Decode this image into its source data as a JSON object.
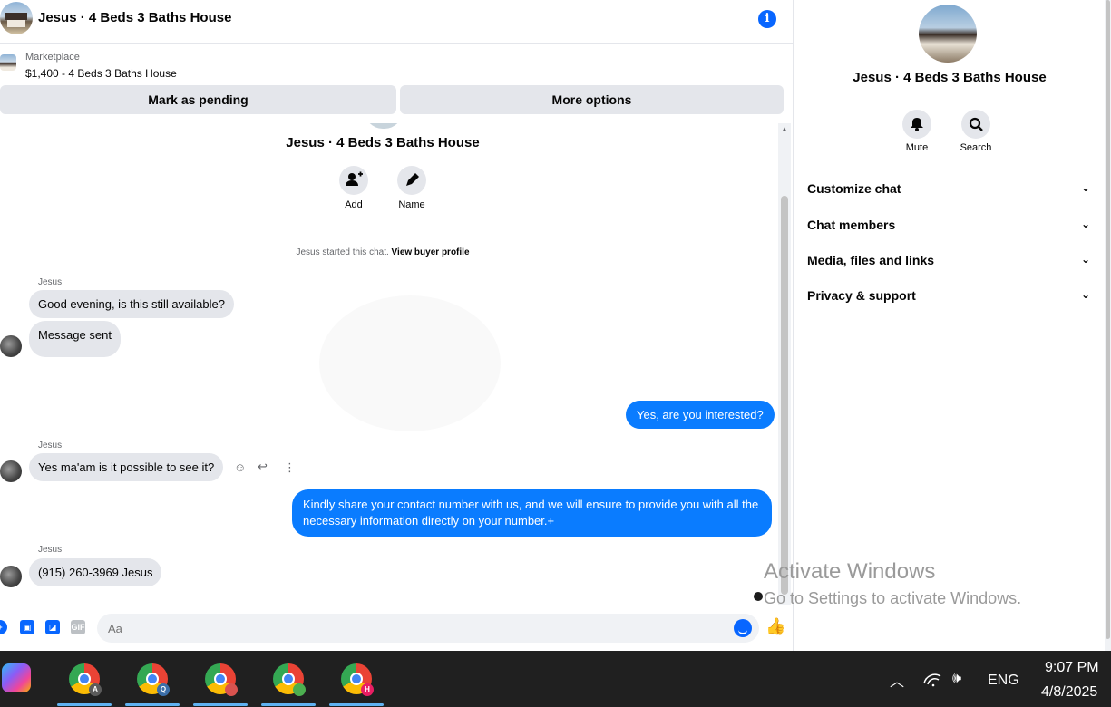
{
  "chat": {
    "title": "Jesus · 4 Beds 3 Baths House",
    "listing_source": "Marketplace",
    "listing_price": "$1,400 - 4 Beds 3 Baths House",
    "mark_pending": "Mark as pending",
    "more_options": "More options"
  },
  "intro": {
    "name": "Jesus · 4 Beds 3 Baths House",
    "add_label": "Add",
    "name_label": "Name",
    "started_text": "Jesus started this chat.",
    "view_profile": "View buyer profile"
  },
  "messages": {
    "sender1": "Jesus",
    "msg1": "Good evening, is this still available?",
    "msg2": "Message sent",
    "out1": "Yes, are you interested?",
    "sender2": "Jesus",
    "msg3": "Yes ma'am is it possible to see it?",
    "out2": "Kindly share your contact number with us, and we will ensure to provide you with all the necessary information directly on your number.+",
    "sender3": "Jesus",
    "msg4": "(915) 260-3969  Jesus"
  },
  "composer": {
    "placeholder": "Aa",
    "gif_label": "GIF"
  },
  "details": {
    "name": "Jesus · 4 Beds 3 Baths House",
    "mute_label": "Mute",
    "search_label": "Search",
    "sections": [
      "Customize chat",
      "Chat members",
      "Media, files and links",
      "Privacy & support"
    ]
  },
  "watermark": {
    "title": "Activate Windows",
    "subtitle": "Go to Settings to activate Windows."
  },
  "taskbar": {
    "lang": "ENG",
    "time": "9:07 PM",
    "date": "4/8/2025",
    "badges": [
      "A",
      "Q",
      "",
      "",
      "H"
    ]
  },
  "colors": {
    "accent": "#0866ff",
    "outgoing_bubble": "#0a7cff",
    "incoming_bubble": "#e4e6eb",
    "taskbar": "#202020"
  }
}
